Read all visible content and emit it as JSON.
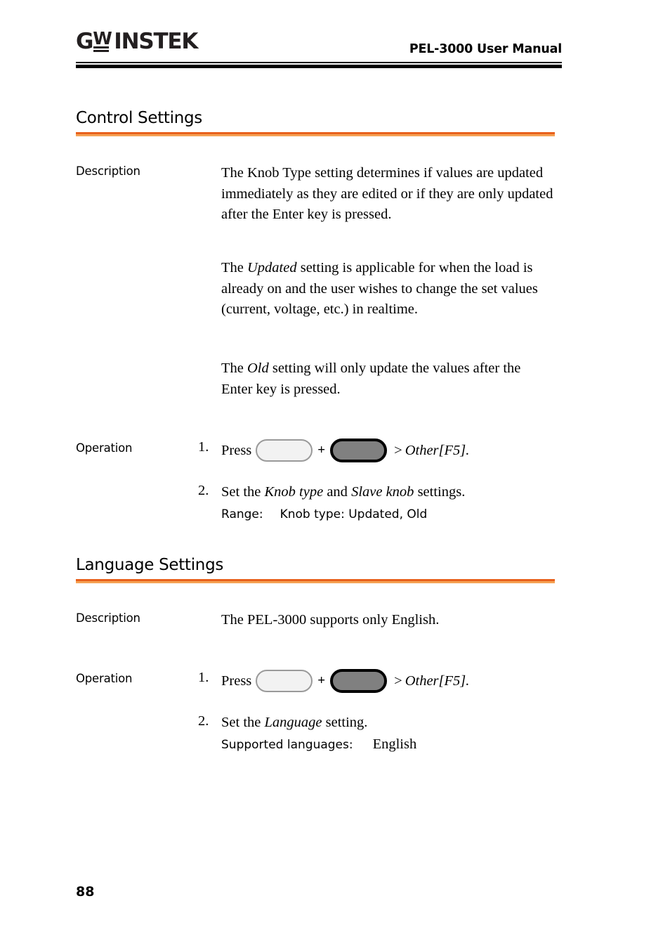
{
  "header": {
    "logo_g": "G",
    "logo_w": "W",
    "logo_instek": "INSTEK",
    "manual_title": "PEL-3000 User Manual"
  },
  "colors": {
    "rule_orange_dark": "#e8601c",
    "rule_orange_light": "#f5a154",
    "header_rule": "#000000",
    "key_light_fill": "#f2f2f2",
    "key_light_border": "#9a9a9a",
    "key_dark_fill": "#808080",
    "key_dark_border": "#000000"
  },
  "sections": [
    {
      "heading": "Control Settings",
      "description_label": "Description",
      "description_paragraphs": [
        {
          "runs": [
            {
              "text": "The Knob Type setting determines if values are updated immediately as they are edited or if they are only updated after the Enter key is pressed.",
              "style": "normal"
            }
          ]
        },
        {
          "runs": [
            {
              "text": "The ",
              "style": "normal"
            },
            {
              "text": "Updated",
              "style": "italic"
            },
            {
              "text": " setting is applicable for when the load is already on and the user wishes to change the set values (current, voltage, etc.) in realtime.",
              "style": "normal"
            }
          ]
        },
        {
          "runs": [
            {
              "text": "The ",
              "style": "normal"
            },
            {
              "text": "Old",
              "style": "italic"
            },
            {
              "text": " setting will only update the values after the Enter key is pressed.",
              "style": "normal"
            }
          ]
        }
      ],
      "operation_label": "Operation",
      "steps": [
        {
          "number": "1.",
          "press_word": "Press",
          "key_light": "soft-key-blank",
          "plus": "+",
          "key_dark": "function-key-blank",
          "separator": ">",
          "target": "Other[F5]."
        },
        {
          "number": "2.",
          "line_runs": [
            {
              "text": "Set the ",
              "style": "normal"
            },
            {
              "text": "Knob type",
              "style": "italic"
            },
            {
              "text": " and ",
              "style": "normal"
            },
            {
              "text": "Slave knob",
              "style": "italic"
            },
            {
              "text": " settings.",
              "style": "normal"
            }
          ],
          "range_label": "Range:",
          "range_value": "Knob type: Updated, Old"
        }
      ]
    },
    {
      "heading": "Language Settings",
      "description_label": "Description",
      "description_paragraphs": [
        {
          "runs": [
            {
              "text": "The PEL-3000 supports only English.",
              "style": "normal"
            }
          ]
        }
      ],
      "operation_label": "Operation",
      "steps": [
        {
          "number": "1.",
          "press_word": "Press",
          "key_light": "soft-key-blank",
          "plus": "+",
          "key_dark": "function-key-blank",
          "separator": ">",
          "target": "Other[F5]."
        },
        {
          "number": "2.",
          "line_runs": [
            {
              "text": "Set the ",
              "style": "normal"
            },
            {
              "text": "Language",
              "style": "italic"
            },
            {
              "text": " setting.",
              "style": "normal"
            }
          ],
          "range_label": "Supported languages:",
          "range_value": "English"
        }
      ]
    }
  ],
  "footer": {
    "page_number": "88"
  }
}
